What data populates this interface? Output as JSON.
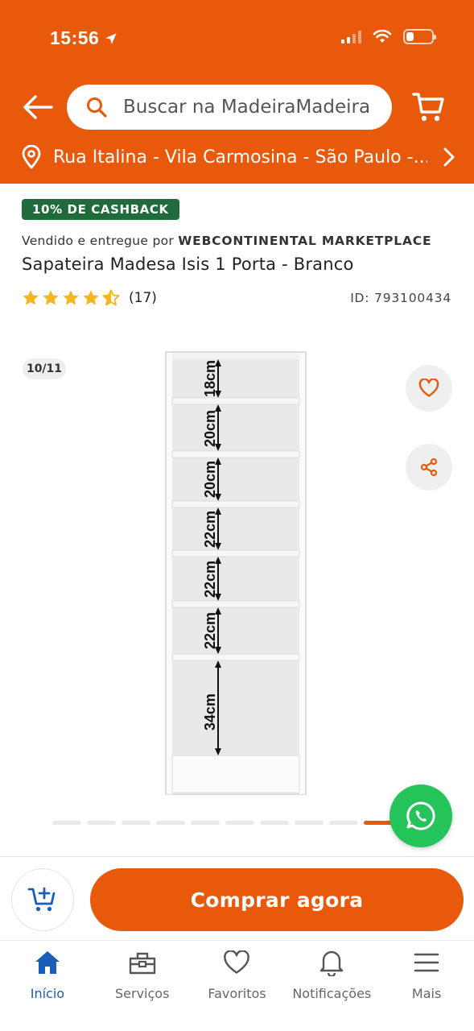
{
  "status_bar": {
    "time": "15:56"
  },
  "header": {
    "search": {
      "placeholder": "Buscar na MadeiraMadeira"
    },
    "address": "Rua Italina - Vila Carmosina - São Paulo -..."
  },
  "product": {
    "cashback_badge": "10% DE CASHBACK",
    "seller_prefix": "Vendido e entregue por",
    "seller_name": "WEBCONTINENTAL MARKETPLACE",
    "title": "Sapateira Madesa Isis 1 Porta - Branco",
    "rating_value": 4.5,
    "rating_count": "(17)",
    "id_label": "ID: 793100434"
  },
  "gallery": {
    "counter": "10/11",
    "current_index": 10,
    "total": 11,
    "image_measurements": [
      "18cm",
      "20cm",
      "20cm",
      "22cm",
      "22cm",
      "22cm",
      "34cm"
    ]
  },
  "actions": {
    "buy_now": "Comprar agora"
  },
  "tab_bar": {
    "items": [
      {
        "label": "Início",
        "icon": "home-icon",
        "active": true
      },
      {
        "label": "Serviços",
        "icon": "toolbox-icon",
        "active": false
      },
      {
        "label": "Favoritos",
        "icon": "heart-icon",
        "active": false
      },
      {
        "label": "Notificações",
        "icon": "bell-icon",
        "active": false
      },
      {
        "label": "Mais",
        "icon": "menu-icon",
        "active": false
      }
    ]
  },
  "colors": {
    "brand_orange": "#e8590c",
    "cashback_green": "#1f6b3b",
    "star_yellow": "#f5b51e",
    "whatsapp_green": "#25c45a",
    "active_tab_blue": "#1a5eb8"
  }
}
